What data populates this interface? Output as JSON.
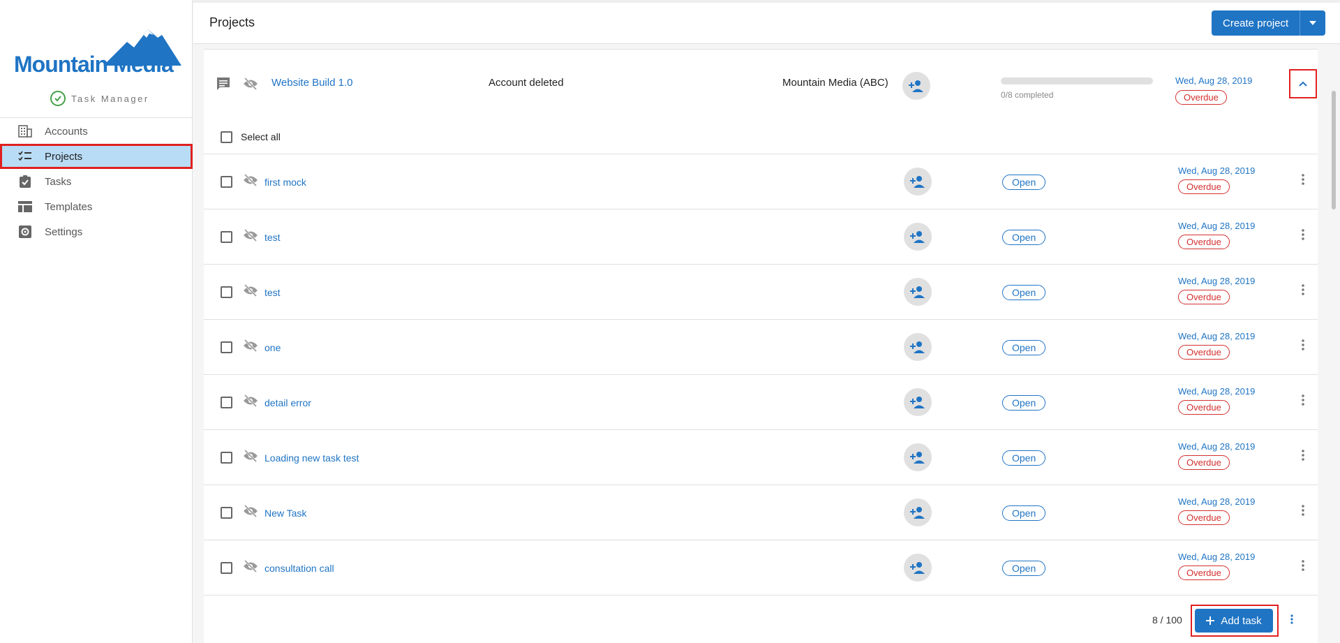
{
  "brand": {
    "name": "Mountain Media",
    "subtitle": "Task Manager",
    "color": "#1f74c4"
  },
  "sidebar": {
    "items": [
      {
        "label": "Accounts",
        "icon": "building-icon"
      },
      {
        "label": "Projects",
        "icon": "checklist-icon",
        "active": true
      },
      {
        "label": "Tasks",
        "icon": "clipboard-check-icon"
      },
      {
        "label": "Templates",
        "icon": "template-icon"
      },
      {
        "label": "Settings",
        "icon": "gear-icon"
      }
    ]
  },
  "header": {
    "title": "Projects",
    "create_label": "Create project"
  },
  "project": {
    "name": "Website Build 1.0",
    "account": "Account deleted",
    "client": "Mountain Media (ABC)",
    "progress_completed": 0,
    "progress_total": 8,
    "progress_label": "0/8 completed",
    "due_date": "Wed, Aug 28, 2019",
    "status": "Overdue"
  },
  "select_all_label": "Select all",
  "tasks": [
    {
      "name": "first mock",
      "state": "Open",
      "due_date": "Wed, Aug 28, 2019",
      "status": "Overdue"
    },
    {
      "name": "test",
      "state": "Open",
      "due_date": "Wed, Aug 28, 2019",
      "status": "Overdue"
    },
    {
      "name": "test",
      "state": "Open",
      "due_date": "Wed, Aug 28, 2019",
      "status": "Overdue"
    },
    {
      "name": "one",
      "state": "Open",
      "due_date": "Wed, Aug 28, 2019",
      "status": "Overdue"
    },
    {
      "name": "detail error",
      "state": "Open",
      "due_date": "Wed, Aug 28, 2019",
      "status": "Overdue"
    },
    {
      "name": "Loading new task test",
      "state": "Open",
      "due_date": "Wed, Aug 28, 2019",
      "status": "Overdue"
    },
    {
      "name": "New Task",
      "state": "Open",
      "due_date": "Wed, Aug 28, 2019",
      "status": "Overdue"
    },
    {
      "name": "consultation call",
      "state": "Open",
      "due_date": "Wed, Aug 28, 2019",
      "status": "Overdue"
    }
  ],
  "footer": {
    "count": "8 / 100",
    "add_task_label": "Add task"
  }
}
